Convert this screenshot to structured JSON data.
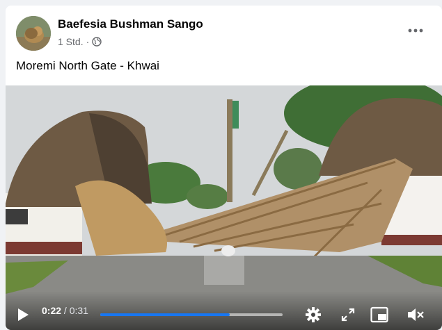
{
  "post": {
    "author": "Baefesia Bushman Sango",
    "timestamp": "1 Std.",
    "separator": "·",
    "privacy_icon": "globe-icon",
    "menu_icon": "more-horizontal-icon",
    "caption": "Moremi North Gate - Khwai"
  },
  "video": {
    "current_time": "0:22",
    "duration": "0:31",
    "time_separator": " / ",
    "progress_fraction": 0.71,
    "controls": [
      "play-icon",
      "settings-gear-icon",
      "fullscreen-icon",
      "picture-in-picture-icon",
      "volume-muted-icon"
    ]
  },
  "colors": {
    "accent": "#1877f2",
    "text_primary": "#050505",
    "text_secondary": "#65676b",
    "background": "#f0f2f5"
  }
}
